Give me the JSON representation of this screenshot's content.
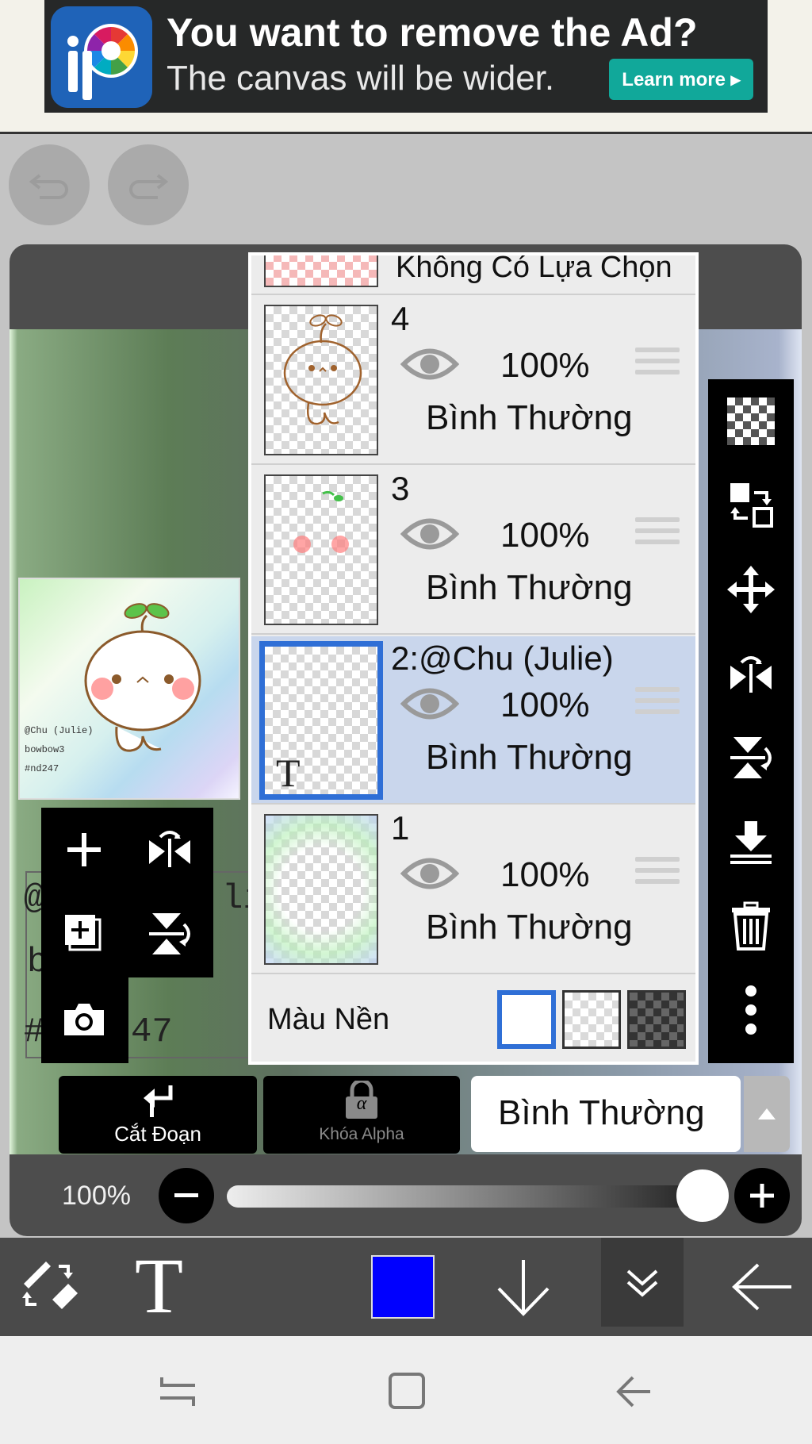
{
  "ad": {
    "title": "You want to remove the Ad?",
    "subtitle": "The canvas will be wider.",
    "learn_more": "Learn more ▸",
    "logo_icon": "ibispaint-logo"
  },
  "history": {
    "undo_icon": "undo-icon",
    "redo_icon": "redo-icon"
  },
  "preview": {
    "lines": [
      "@Chu (Julie)",
      "bowbow3",
      "#nd247"
    ]
  },
  "canvas_text_fragments": [
    "@",
    "li",
    "b",
    "#",
    "47"
  ],
  "layers": {
    "selection_row": {
      "label": "Không Có Lựa Chọn"
    },
    "items": [
      {
        "name": "4",
        "opacity": "100%",
        "blend": "Bình Thường",
        "selected": false
      },
      {
        "name": "3",
        "opacity": "100%",
        "blend": "Bình Thường",
        "selected": false
      },
      {
        "name": "2:@Chu (Julie)",
        "opacity": "100%",
        "blend": "Bình Thường",
        "selected": true,
        "thumb_glyph": "T"
      },
      {
        "name": "1",
        "opacity": "100%",
        "blend": "Bình Thường",
        "selected": false
      }
    ],
    "background": {
      "label": "Màu Nền"
    }
  },
  "right_tools": [
    "checker-icon",
    "swap-icon",
    "move-icon",
    "flip-horizontal-icon",
    "flip-vertical-icon",
    "merge-down-icon",
    "trash-icon",
    "more-icon"
  ],
  "bottom_buttons": {
    "clipping": "Cắt Đoạn",
    "alpha_lock": "Khóa Alpha",
    "alpha_symbol": "α",
    "blend_mode": "Bình Thường"
  },
  "opacity_slider": {
    "label": "100%",
    "value": 1.0
  },
  "toolbar": {
    "text_tool": "T",
    "color": "#0000ff"
  },
  "colors": {
    "selected_border": "#2f6fd6",
    "selected_bg": "#c9d6ec",
    "accent_ad": "#11a89a"
  }
}
